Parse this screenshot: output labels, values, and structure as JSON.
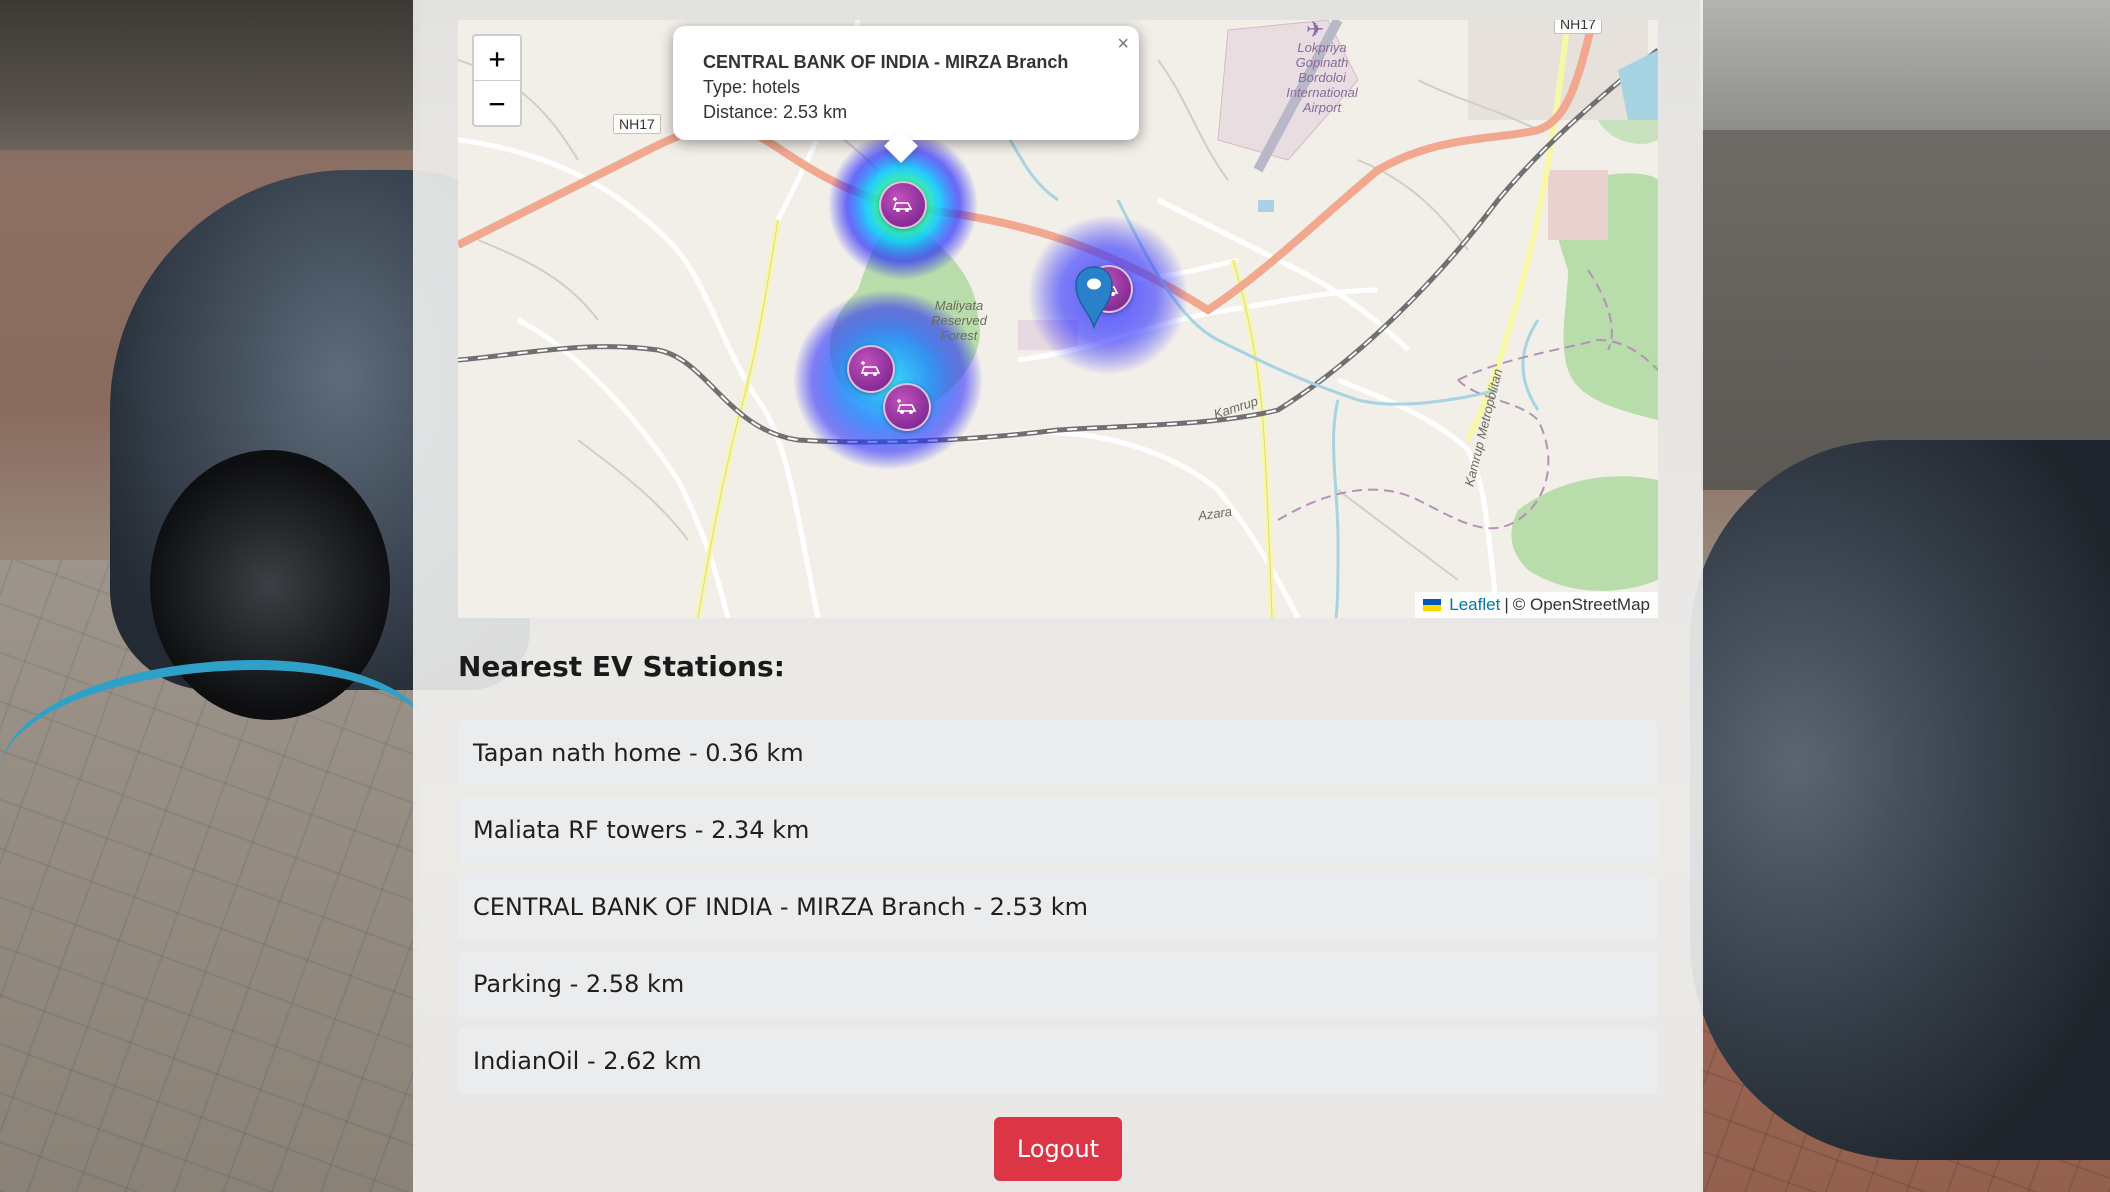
{
  "map": {
    "zoom_in_label": "+",
    "zoom_out_label": "−",
    "popup": {
      "title": "CENTRAL BANK OF INDIA - MIRZA Branch",
      "type_line": "Type: hotels",
      "distance_line": "Distance: 2.53 km",
      "close_label": "×"
    },
    "labels": {
      "nh17_left": "NH17",
      "nh17_top": "NH17",
      "forest": "Maliyata Reserved Forest",
      "airport": "Lokpriya Gopinath Bordoloi International Airport",
      "kamrup": "Kamrup",
      "kamrup_metro": "Kamrup Metropolitan",
      "azara": "Azara"
    },
    "markers": [
      {
        "name": "ev-marker",
        "icon": "ev-charging-icon"
      },
      {
        "name": "ev-marker",
        "icon": "ev-charging-icon"
      },
      {
        "name": "ev-marker",
        "icon": "ev-charging-icon"
      },
      {
        "name": "ev-marker",
        "icon": "ev-charging-icon"
      },
      {
        "name": "user-location-marker",
        "icon": "location-pin-icon"
      }
    ],
    "attribution": {
      "leaflet": "Leaflet",
      "separator": "|",
      "osm": "© OpenStreetMap"
    }
  },
  "stations": {
    "heading": "Nearest EV Stations:",
    "items": [
      {
        "label": "Tapan nath home - 0.36 km"
      },
      {
        "label": "Maliata RF towers - 2.34 km"
      },
      {
        "label": "CENTRAL BANK OF INDIA - MIRZA Branch - 2.53 km"
      },
      {
        "label": "Parking - 2.58 km"
      },
      {
        "label": "IndianOil - 2.62 km"
      }
    ]
  },
  "logout_label": "Logout",
  "colors": {
    "logout_bg": "#dc3545",
    "marker_purple": "#8b2e9a",
    "pin_blue": "#2a81cb",
    "leaflet_link": "#0078a8"
  }
}
